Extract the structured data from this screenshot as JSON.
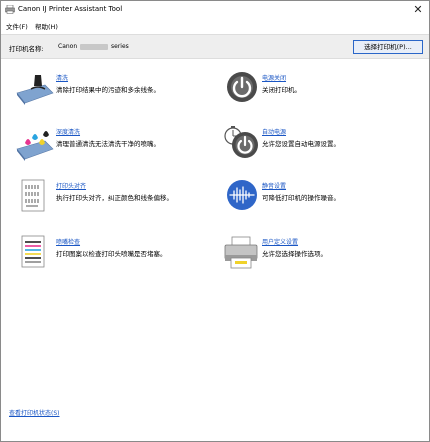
{
  "window": {
    "title": "Canon IJ Printer Assistant Tool",
    "close_glyph": "✕"
  },
  "menu": [
    {
      "label": "文件(F)"
    },
    {
      "label": "帮助(H)"
    }
  ],
  "printer": {
    "label": "打印机名称:",
    "name_prefix": "Canon",
    "name_suffix": "series",
    "select_button": "选择打印机(P)..."
  },
  "functions": [
    {
      "id": "cleaning",
      "link": "清洗",
      "desc": "清除打印结果中的污迹和多余线条。",
      "icon": "cleaning-icon"
    },
    {
      "id": "power-off",
      "link": "电源关闭",
      "desc": "关闭打印机。",
      "icon": "power-icon"
    },
    {
      "id": "deep-cleaning",
      "link": "深度清洗",
      "desc": "清理普通清洗无法清洗干净的喷嘴。",
      "icon": "deep-cleaning-icon"
    },
    {
      "id": "auto-power",
      "link": "自动电源",
      "desc": "允许您设置自动电源设置。",
      "icon": "auto-power-icon"
    },
    {
      "id": "print-head-alignment",
      "link": "打印头对齐",
      "desc": "执行打印头对齐，纠正颜色和线条偏移。",
      "icon": "alignment-icon"
    },
    {
      "id": "quiet-settings",
      "link": "静音设置",
      "desc": "可降低打印机的操作噪音。",
      "icon": "quiet-icon"
    },
    {
      "id": "nozzle-check",
      "link": "喷嘴检查",
      "desc": "打印图案以检查打印头喷嘴是否堵塞。",
      "icon": "nozzle-check-icon"
    },
    {
      "id": "custom-settings",
      "link": "用户定义设置",
      "desc": "允许您选择操作选项。",
      "icon": "custom-settings-icon"
    }
  ],
  "footer": {
    "status_link": "查看打印机状态(S)"
  },
  "colors": {
    "link": "#1a56c4",
    "power_icon": "#4a4a4a",
    "quiet_icon": "#2f66c8"
  }
}
